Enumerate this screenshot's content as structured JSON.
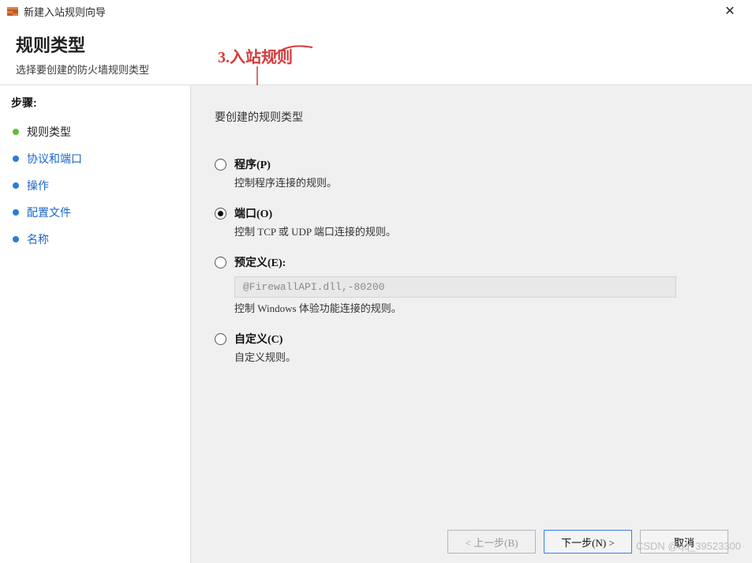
{
  "titlebar": {
    "icon_name": "firewall-wizard-icon",
    "title": "新建入站规则向导"
  },
  "header": {
    "title": "规则类型",
    "subtitle": "选择要创建的防火墙规则类型"
  },
  "annotation": {
    "text": "3.入站规则"
  },
  "sidebar": {
    "steps_title": "步骤:",
    "items": [
      {
        "label": "规则类型",
        "active": false
      },
      {
        "label": "协议和端口",
        "active": true
      },
      {
        "label": "操作",
        "active": false
      },
      {
        "label": "配置文件",
        "active": false
      },
      {
        "label": "名称",
        "active": false
      }
    ]
  },
  "content": {
    "heading": "要创建的规则类型",
    "options": [
      {
        "label": "程序(P)",
        "desc": "控制程序连接的规则。",
        "checked": false
      },
      {
        "label": "端口(O)",
        "desc": "控制 TCP 或 UDP 端口连接的规则。",
        "checked": true
      },
      {
        "label": "预定义(E):",
        "desc": "控制 Windows 体验功能连接的规则。",
        "checked": false,
        "has_select": true,
        "select_value": "@FirewallAPI.dll,-80200"
      },
      {
        "label": "自定义(C)",
        "desc": "自定义规则。",
        "checked": false
      }
    ]
  },
  "buttons": {
    "back": "< 上一步(B)",
    "next": "下一步(N) >",
    "cancel": "取消"
  },
  "watermark": "CSDN @qq_39523300"
}
